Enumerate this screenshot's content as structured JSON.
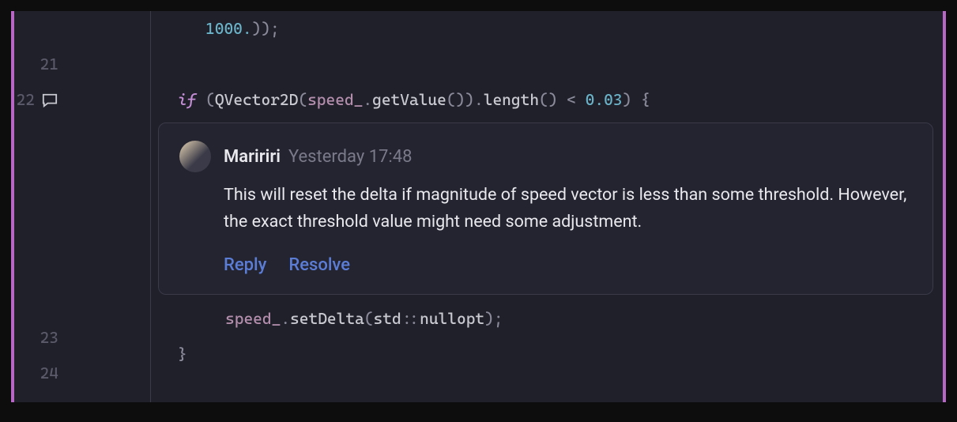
{
  "lines": {
    "l20": {
      "number": "",
      "tokens": {
        "number": "1000.",
        "paren": "))",
        "semi": ";"
      }
    },
    "l21": {
      "number": "21"
    },
    "l22": {
      "number": "22",
      "tokens": {
        "if": "if",
        "open": " (",
        "type": "QVector2D",
        "open2": "(",
        "var": "speed_",
        "dot1": ".",
        "m1": "getValue",
        "p1": "()).",
        "m2": "length",
        "p2": "() ",
        "lt": "<",
        "sp": " ",
        "num": "0.03",
        "close": ") {",
        "brace": ""
      }
    },
    "l23": {
      "number": "23",
      "tokens": {
        "var": "speed_",
        "dot": ".",
        "m": "setDelta",
        "open": "(",
        "ns": "std",
        "cc": "::",
        "null": "nullopt",
        "close": ");"
      }
    },
    "l24": {
      "number": "24",
      "tokens": {
        "brace": "}"
      }
    }
  },
  "comment": {
    "author": "Maririri",
    "timestamp": "Yesterday 17:48",
    "body": "This will reset the delta if magnitude of speed vector is less than some threshold. However, the exact threshold value might need some adjustment.",
    "actions": {
      "reply": "Reply",
      "resolve": "Resolve"
    }
  }
}
